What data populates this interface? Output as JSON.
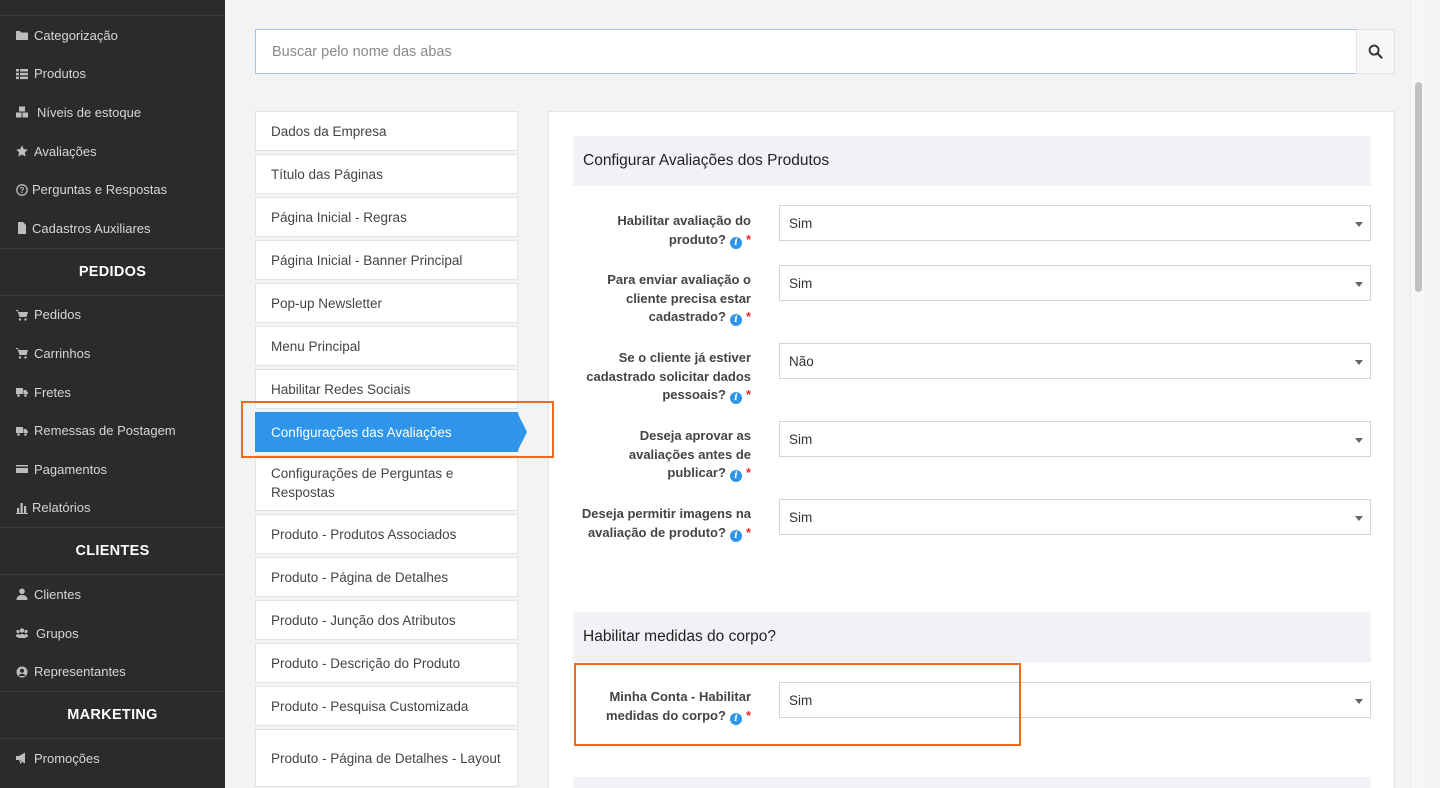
{
  "sidebar": {
    "catalog_items": [
      {
        "label": "Categorização",
        "icon": "folder-icon"
      },
      {
        "label": "Produtos",
        "icon": "list-icon"
      },
      {
        "label": "Níveis de estoque",
        "icon": "cubes-icon"
      },
      {
        "label": "Avaliações",
        "icon": "star-icon"
      },
      {
        "label": "Perguntas e Respostas",
        "icon": "question-circle-icon"
      },
      {
        "label": "Cadastros Auxiliares",
        "icon": "file-icon"
      }
    ],
    "pedidos_heading": "PEDIDOS",
    "pedidos_items": [
      {
        "label": "Pedidos",
        "icon": "cart-icon"
      },
      {
        "label": "Carrinhos",
        "icon": "cart-icon"
      },
      {
        "label": "Fretes",
        "icon": "truck-icon"
      },
      {
        "label": "Remessas de Postagem",
        "icon": "truck-icon"
      },
      {
        "label": "Pagamentos",
        "icon": "credit-card-icon"
      },
      {
        "label": "Relatórios",
        "icon": "bar-chart-icon"
      }
    ],
    "clientes_heading": "CLIENTES",
    "clientes_items": [
      {
        "label": "Clientes",
        "icon": "user-icon"
      },
      {
        "label": "Grupos",
        "icon": "users-icon"
      },
      {
        "label": "Representantes",
        "icon": "user-circle-icon"
      }
    ],
    "marketing_heading": "MARKETING",
    "marketing_items": [
      {
        "label": "Promoções",
        "icon": "bullhorn-icon"
      }
    ]
  },
  "search": {
    "placeholder": "Buscar pelo nome das abas",
    "value": ""
  },
  "tabs": [
    {
      "label": "Dados da Empresa"
    },
    {
      "label": "Título das Páginas"
    },
    {
      "label": "Página Inicial - Regras"
    },
    {
      "label": "Página Inicial - Banner Principal"
    },
    {
      "label": "Pop-up Newsletter"
    },
    {
      "label": "Menu Principal"
    },
    {
      "label": "Habilitar Redes Sociais"
    },
    {
      "label": "Configurações das Avaliações"
    },
    {
      "label": "Configurações de Perguntas e Respostas"
    },
    {
      "label": "Produto - Produtos Associados"
    },
    {
      "label": "Produto - Página de Detalhes"
    },
    {
      "label": "Produto - Junção dos Atributos"
    },
    {
      "label": "Produto - Descrição do Produto"
    },
    {
      "label": "Produto - Pesquisa Customizada"
    },
    {
      "label": "Produto - Página de Detalhes - Layout"
    }
  ],
  "active_tab": "Configurações das Avaliações",
  "section1": {
    "title": "Configurar Avaliações dos Produtos",
    "fields": [
      {
        "label": "Habilitar avaliação do produto?",
        "value": "Sim"
      },
      {
        "label": "Para enviar avaliação o cliente precisa estar cadastrado?",
        "value": "Sim"
      },
      {
        "label": "Se o cliente já estiver cadastrado solicitar dados pessoais?",
        "value": "Não"
      },
      {
        "label": "Deseja aprovar as avaliações antes de publicar?",
        "value": "Sim"
      },
      {
        "label": "Deseja permitir imagens na avaliação de produto?",
        "value": "Sim"
      }
    ]
  },
  "section2": {
    "title": "Habilitar medidas do corpo?",
    "fields": [
      {
        "label": "Minha Conta - Habilitar medidas do corpo?",
        "value": "Sim"
      }
    ]
  },
  "colors": {
    "accent": "#2e95ea",
    "highlight": "#ee6a1d",
    "sidebar_bg": "#2b2b2b",
    "required": "#e03030"
  }
}
